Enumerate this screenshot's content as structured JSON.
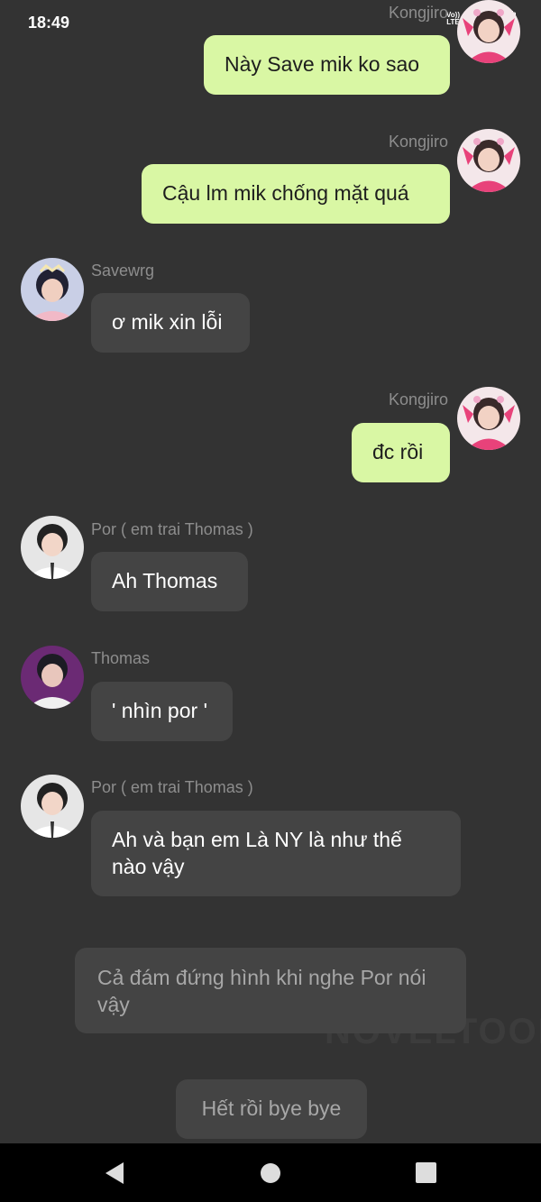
{
  "status_bar": {
    "time": "18:49",
    "volte_top": "Vo))",
    "volte_bottom": "LTE"
  },
  "messages": [
    {
      "sender": "Kongjiro",
      "text": "Này Save mik ko sao",
      "side": "right"
    },
    {
      "sender": "Kongjiro",
      "text": "Cậu lm mik chống mặt quá",
      "side": "right"
    },
    {
      "sender": "Savewrg",
      "text": "ơ mik xin lỗi",
      "side": "left"
    },
    {
      "sender": "Kongjiro",
      "text": "đc rồi",
      "side": "right"
    },
    {
      "sender": "Por ( em trai Thomas )",
      "text": "Ah Thomas",
      "side": "left"
    },
    {
      "sender": "Thomas",
      "text": "' nhìn por '",
      "side": "left"
    },
    {
      "sender": "Por ( em trai Thomas )",
      "text": "Ah và bạn em Là NY là như thế nào vậy",
      "side": "left"
    }
  ],
  "narrations": [
    "Cả đám đứng hình khi nghe Por nói vậy",
    "Hết rồi bye bye"
  ],
  "watermark": "NOVELTOON",
  "colors": {
    "background": "#333333",
    "my_bubble": "#d9f7a4",
    "their_bubble": "#444444",
    "sender_name": "#8d8d8d",
    "nav_bar": "#000000"
  },
  "navigation": {
    "back": "back-icon",
    "home": "home-icon",
    "recents": "recents-icon"
  }
}
